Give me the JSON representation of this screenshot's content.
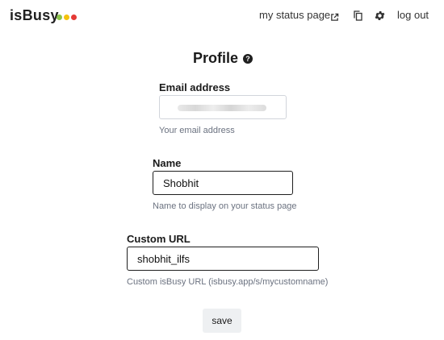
{
  "header": {
    "logo": "isBusy",
    "dots": [
      "#8bc34a",
      "#f4c20d",
      "#e53935"
    ],
    "status_link": "my status page",
    "logout": "log out"
  },
  "icons": {
    "external_link": "external-link-icon",
    "copy": "copy-icon",
    "settings": "gear-icon",
    "help": "question-mark-icon"
  },
  "profile": {
    "title": "Profile",
    "email": {
      "label": "Email address",
      "value": "",
      "hint": "Your email address"
    },
    "name": {
      "label": "Name",
      "value": "Shobhit",
      "hint": "Name to display on your status page"
    },
    "custom_url": {
      "label": "Custom URL",
      "value": "shobhit_ilfs",
      "hint": "Custom isBusy URL (isbusy.app/s/mycustomname)"
    },
    "save_label": "save"
  }
}
